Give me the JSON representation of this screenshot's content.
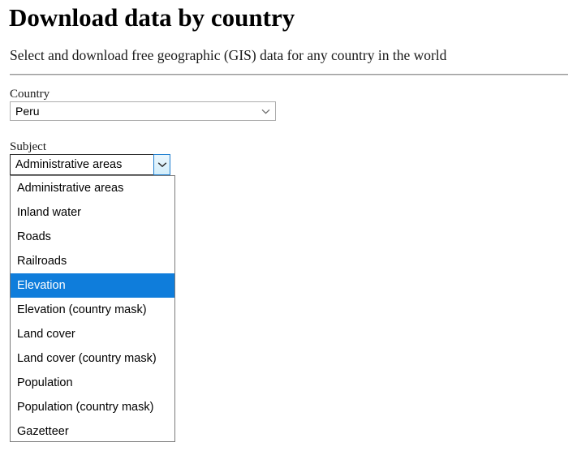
{
  "page": {
    "title": "Download data by country",
    "subtitle": "Select and download free geographic (GIS) data for any country in the world"
  },
  "colors": {
    "highlight": "#0f7ddb",
    "highlight_text": "#ffffff",
    "focus_border": "#2b2b2b",
    "arrow_button_border": "#1f7fd0",
    "arrow_button_fill": "#d3eefb",
    "field_border": "#adadad",
    "list_border": "#7a7a7a",
    "page_background": "#ffffff",
    "text": "#000000"
  },
  "form": {
    "country": {
      "label": "Country",
      "value": "Peru",
      "arrow_icon": "chevron-down-icon"
    },
    "subject": {
      "label": "Subject",
      "value": "Administrative areas",
      "arrow_icon": "chevron-down-icon",
      "expanded": true,
      "highlighted_option": "Elevation",
      "options": [
        "Administrative areas",
        "Inland water",
        "Roads",
        "Railroads",
        "Elevation",
        "Elevation (country mask)",
        "Land cover",
        "Land cover (country mask)",
        "Population",
        "Population (country mask)",
        "Gazetteer"
      ]
    }
  }
}
